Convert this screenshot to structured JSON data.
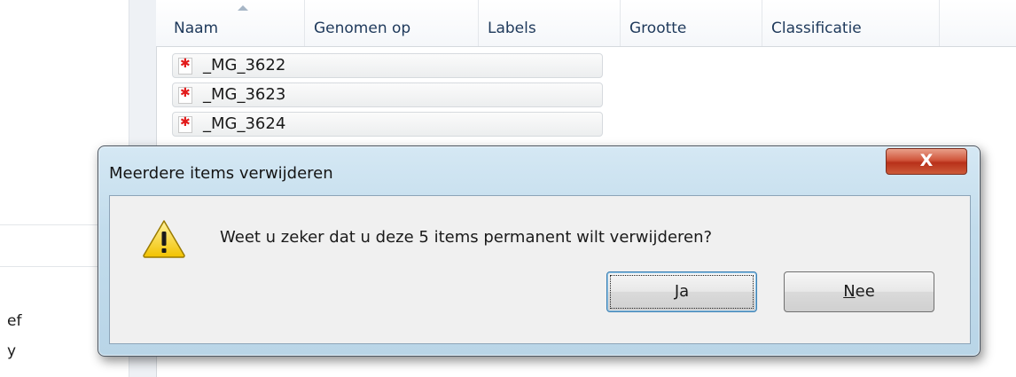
{
  "left_pane": {
    "items": [
      "ef",
      "y"
    ]
  },
  "file_list": {
    "columns": [
      "Naam",
      "Genomen op",
      "Labels",
      "Grootte",
      "Classificatie"
    ],
    "files": [
      "_MG_3622",
      "_MG_3623",
      "_MG_3624"
    ]
  },
  "dialog": {
    "title": "Meerdere items verwijderen",
    "close_label": "X",
    "message": "Weet u zeker dat u deze 5 items permanent wilt verwijderen?",
    "yes_mnemonic": "J",
    "yes_rest": "a",
    "no_mnemonic": "N",
    "no_rest": "ee",
    "icon": "warning-icon"
  },
  "colors": {
    "dialog_frame": "#c2dcec",
    "close_button": "#c9452a",
    "default_button_border": "#3c7fb1"
  }
}
